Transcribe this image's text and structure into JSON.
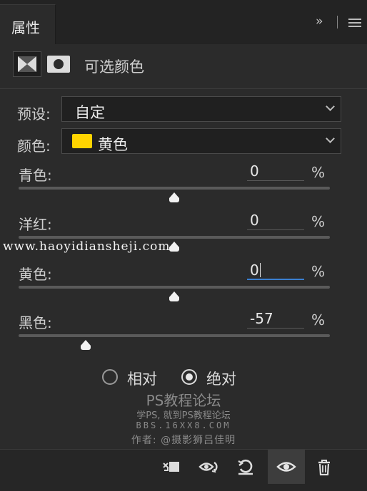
{
  "panel": {
    "tab_label": "属性",
    "collapse_glyph": "››"
  },
  "adjustment": {
    "title": "可选颜色"
  },
  "preset": {
    "label": "预设:",
    "value": "自定"
  },
  "colors": {
    "label": "颜色:",
    "value": "黄色",
    "swatch_color": "#ffd400"
  },
  "sliders": [
    {
      "label": "青色:",
      "value": "0",
      "unit": "%",
      "level": 0
    },
    {
      "label": "洋红:",
      "value": "0",
      "unit": "%",
      "level": 0
    },
    {
      "label": "黄色:",
      "value": "0",
      "unit": "%",
      "level": 0,
      "focused": true
    },
    {
      "label": "黑色:",
      "value": "-57",
      "unit": "%",
      "level": -57
    }
  ],
  "method": {
    "relative_label": "相对",
    "absolute_label": "绝对",
    "selected": "absolute"
  },
  "watermark": {
    "url": "www.haoyidiansheji.com",
    "site_title": "PS教程论坛",
    "site_sub": "学PS, 就到PS教程论坛",
    "site_bbs": "BBS.16XX8.COM",
    "author": "作者: @摄影狮吕佳明"
  },
  "footer_icons": [
    "clip-to-layer-icon",
    "view-previous-state-icon",
    "reset-icon",
    "visibility-eye-icon",
    "trash-icon"
  ],
  "accent_color": "#3a7fd0"
}
